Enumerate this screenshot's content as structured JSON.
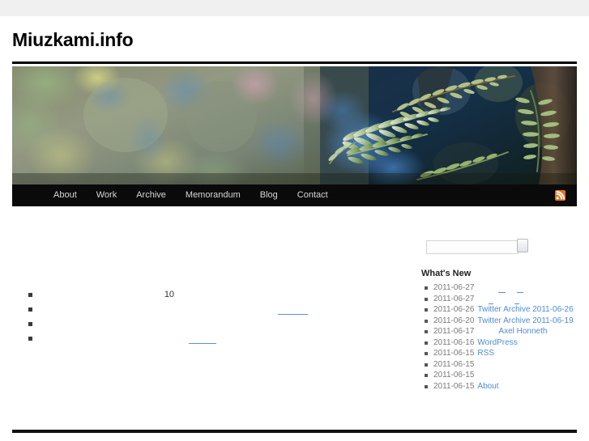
{
  "site": {
    "title": "Miuzkami.info"
  },
  "nav": {
    "items": [
      {
        "label": "About",
        "name": "nav-item-about"
      },
      {
        "label": "Work",
        "name": "nav-item-work"
      },
      {
        "label": "Archive",
        "name": "nav-item-archive"
      },
      {
        "label": "Memorandum",
        "name": "nav-item-memorandum"
      },
      {
        "label": "Blog",
        "name": "nav-item-blog"
      },
      {
        "label": "Contact",
        "name": "nav-item-contact"
      }
    ],
    "rss_icon": "rss-feed-icon",
    "rss_color": "#e8721c"
  },
  "banner": {
    "alt": "fern-fronds-photo"
  },
  "search": {
    "value": "",
    "placeholder": "",
    "button_label": ""
  },
  "sidebar": {
    "heading": "What's New",
    "items": [
      {
        "date": "2011-06-27",
        "link": "",
        "link_visible": false,
        "extra": "",
        "name": "news-item-1"
      },
      {
        "date": "2011-06-27",
        "link": "",
        "link_visible": false,
        "extra": "",
        "name": "news-item-2"
      },
      {
        "date": "2011-06-26",
        "link": "Twitter Archive 2011-06-26",
        "link_visible": true,
        "extra": "",
        "name": "news-item-3"
      },
      {
        "date": "2011-06-20",
        "link": "Twitter Archive 2011-06-19",
        "link_visible": true,
        "extra": "",
        "name": "news-item-4"
      },
      {
        "date": "2011-06-17",
        "link": "Axel Honneth",
        "link_visible": true,
        "extra": "",
        "name": "news-item-5"
      },
      {
        "date": "2011-06-16",
        "link": "WordPress",
        "link_visible": true,
        "extra": "",
        "name": "news-item-6"
      },
      {
        "date": "2011-06-15",
        "link": "RSS",
        "link_visible": true,
        "extra": "",
        "name": "news-item-7"
      },
      {
        "date": "2011-06-15",
        "link": "",
        "link_visible": false,
        "extra": "",
        "name": "news-item-8"
      },
      {
        "date": "2011-06-15",
        "link": "",
        "link_visible": false,
        "extra": "",
        "name": "news-item-9"
      },
      {
        "date": "2011-06-15",
        "link": "About",
        "link_visible": true,
        "extra": "",
        "name": "news-item-10"
      }
    ]
  },
  "main": {
    "items": [
      {
        "text": "10",
        "has_link": false,
        "name": "content-item-1"
      },
      {
        "text": "",
        "has_link": true,
        "name": "content-item-2"
      },
      {
        "text": "",
        "has_link": false,
        "name": "content-item-3"
      },
      {
        "text": "",
        "has_link": true,
        "name": "content-item-4"
      }
    ]
  },
  "colors": {
    "nav_background": "#0a0a0a",
    "link": "#4f8bd8",
    "accent_rss": "#e8721c",
    "topbar": "#f0f0f0"
  }
}
